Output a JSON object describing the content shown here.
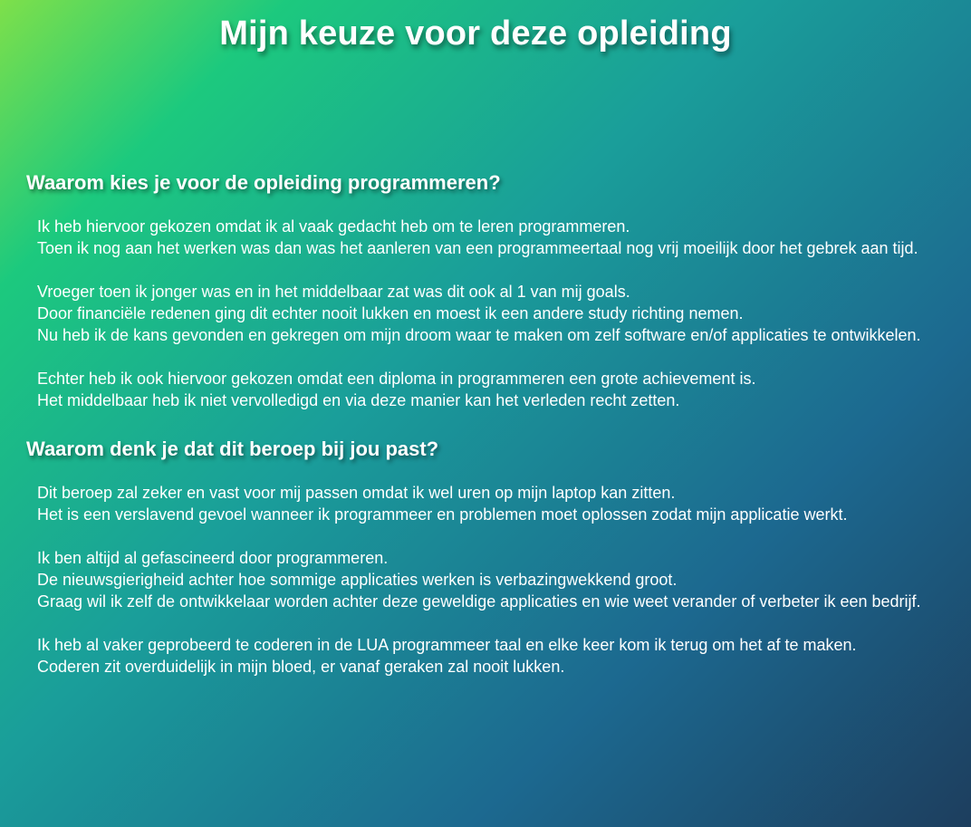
{
  "page": {
    "title": "Mijn keuze voor deze opleiding"
  },
  "sections": [
    {
      "heading": "Waarom kies je voor de opleiding programmeren?",
      "paragraphs": [
        [
          "Ik heb hiervoor gekozen omdat ik al vaak gedacht heb om te leren programmeren.",
          "Toen ik nog aan het werken was dan was het aanleren van een programmeertaal nog vrij moeilijk door het gebrek aan tijd."
        ],
        [
          "Vroeger toen ik jonger was en in het middelbaar zat was dit ook al 1 van mij goals.",
          "Door financiële redenen ging dit echter nooit lukken en moest ik een andere study richting nemen.",
          "Nu heb ik de kans gevonden en gekregen om mijn droom waar te maken om zelf software en/of applicaties te ontwikkelen."
        ],
        [
          "Echter heb ik ook hiervoor gekozen omdat een diploma in programmeren een grote achievement is.",
          "Het middelbaar heb ik niet vervolledigd en via deze manier kan het verleden recht zetten."
        ]
      ]
    },
    {
      "heading": "Waarom denk je dat dit beroep bij jou past?",
      "paragraphs": [
        [
          "Dit beroep zal zeker en vast voor mij passen omdat ik wel uren op mijn laptop kan zitten.",
          "Het is een verslavend gevoel wanneer ik programmeer en problemen moet oplossen zodat mijn applicatie werkt."
        ],
        [
          "Ik ben altijd al gefascineerd door programmeren.",
          "De nieuwsgierigheid achter hoe sommige applicaties werken is verbazingwekkend groot.",
          "Graag wil ik zelf de ontwikkelaar worden achter deze geweldige applicaties en wie weet verander of verbeter ik een bedrijf."
        ],
        [
          "Ik heb al vaker geprobeerd te coderen in de LUA programmeer taal en elke keer kom ik terug om het af te maken.",
          "Coderen zit overduidelijk in mijn bloed, er vanaf geraken zal nooit lukken."
        ]
      ]
    }
  ]
}
